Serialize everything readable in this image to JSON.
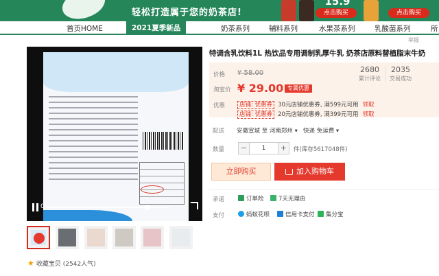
{
  "banner": {
    "slogan": "轻松打造属于您的奶茶店!",
    "price_fragment": "15.9",
    "buy_label": "点击购买",
    "buy_label2": "点击购买"
  },
  "nav": {
    "items": [
      "首页HOME",
      "2021夏季新品",
      "奶茶系列",
      "辅料系列",
      "水果茶系列",
      "乳酸菌系列",
      "所"
    ],
    "active_index": 1
  },
  "video": {
    "time": "0",
    "progress": 0.82
  },
  "favorite": {
    "label": "收藏宝贝",
    "popularity": "(2542人气)"
  },
  "product": {
    "title": "特调含乳饮料1L 热饮品专用调制乳厚牛乳 奶茶店原料替植脂末牛奶",
    "report": "举报",
    "price_label": "价格",
    "original_price": "¥ 58.00",
    "taobao_price_label": "淘宝价",
    "current_price": "¥ 29.00",
    "promo_badge": "专属优惠",
    "stats": [
      {
        "num": "2680",
        "cap": "累计评论"
      },
      {
        "num": "2035",
        "cap": "交易成功"
      }
    ],
    "coupon_label": "优惠",
    "coupons": [
      {
        "tag": "店铺: 优惠券",
        "text": "30元店铺优惠券, 满599元可用",
        "action": "领取"
      },
      {
        "tag": "店铺: 优惠券",
        "text": "20元店铺优惠券, 满399元可用",
        "action": "领取"
      }
    ],
    "shipping_label": "配送",
    "shipping_from": "安徽宣城 至",
    "shipping_to": "河南郑州",
    "shipping_fee": "快递 免运费",
    "quantity_label": "数量",
    "quantity": "1",
    "stock": "件(库存5617048件)",
    "buy_now": "立即购买",
    "add_cart": "加入购物车",
    "promise_label": "承诺",
    "promises": [
      "订单险",
      "7天无理由"
    ],
    "payment_label": "支付",
    "payments": [
      "蚂蚁花呗",
      "信用卡支付",
      "集分宝"
    ]
  }
}
